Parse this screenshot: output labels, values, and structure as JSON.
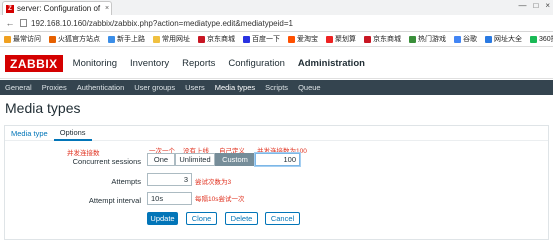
{
  "browser": {
    "tab_title": "server: Configuration of ...",
    "tab_close": "×",
    "favicon": "Z",
    "url": "192.168.10.160/zabbix/zabbix.php?action=mediatype.edit&mediatypeid=1",
    "window_controls": [
      "—",
      "□",
      "×"
    ],
    "bookmarks": [
      {
        "label": "最常访问",
        "color": "#f0a020"
      },
      {
        "label": "火狐官方站点",
        "color": "#e66000"
      },
      {
        "label": "新手上路",
        "color": "#3b8ee8"
      },
      {
        "label": "常用网址",
        "color": "#f0c040"
      },
      {
        "label": "京东商城",
        "color": "#c81623"
      },
      {
        "label": "百度一下",
        "color": "#2932e1"
      },
      {
        "label": "爱淘宝",
        "color": "#ff5000"
      },
      {
        "label": "聚划算",
        "color": "#e22"
      },
      {
        "label": "京东商城",
        "color": "#c81623"
      },
      {
        "label": "热门游戏",
        "color": "#3a8f3a"
      },
      {
        "label": "谷歌",
        "color": "#4285f4"
      },
      {
        "label": "网址大全",
        "color": "#2a7ae2"
      },
      {
        "label": "360搜",
        "color": "#19b955"
      }
    ]
  },
  "app": {
    "logo": "ZABBIX",
    "main_menu": [
      "Monitoring",
      "Inventory",
      "Reports",
      "Configuration",
      "Administration"
    ],
    "sub_menu": [
      "General",
      "Proxies",
      "Authentication",
      "User groups",
      "Users",
      "Media types",
      "Scripts",
      "Queue"
    ],
    "page_title": "Media types"
  },
  "form": {
    "tabs": [
      "Media type",
      "Options"
    ],
    "concurrent_sessions": {
      "label": "Concurrent sessions",
      "options": [
        "One",
        "Unlimited",
        "Custom"
      ],
      "selected": "Custom",
      "value": "100"
    },
    "attempts": {
      "label": "Attempts",
      "value": "3"
    },
    "attempt_interval": {
      "label": "Attempt interval",
      "value": "10s"
    },
    "buttons": {
      "update": "Update",
      "clone": "Clone",
      "delete": "Delete",
      "cancel": "Cancel"
    }
  },
  "annotations": {
    "concurrent": "并发连接数",
    "one": "一次一个",
    "unlimited": "没有上线",
    "custom": "自己定义",
    "custom_value": "并发连接数为100",
    "attempts": "尝试次数为3",
    "interval": "每隔10s尝试一次"
  },
  "colors": {
    "brand": "#d40000",
    "subnav": "#34444f",
    "primary": "#0275b8",
    "annotation": "#e0301e"
  }
}
